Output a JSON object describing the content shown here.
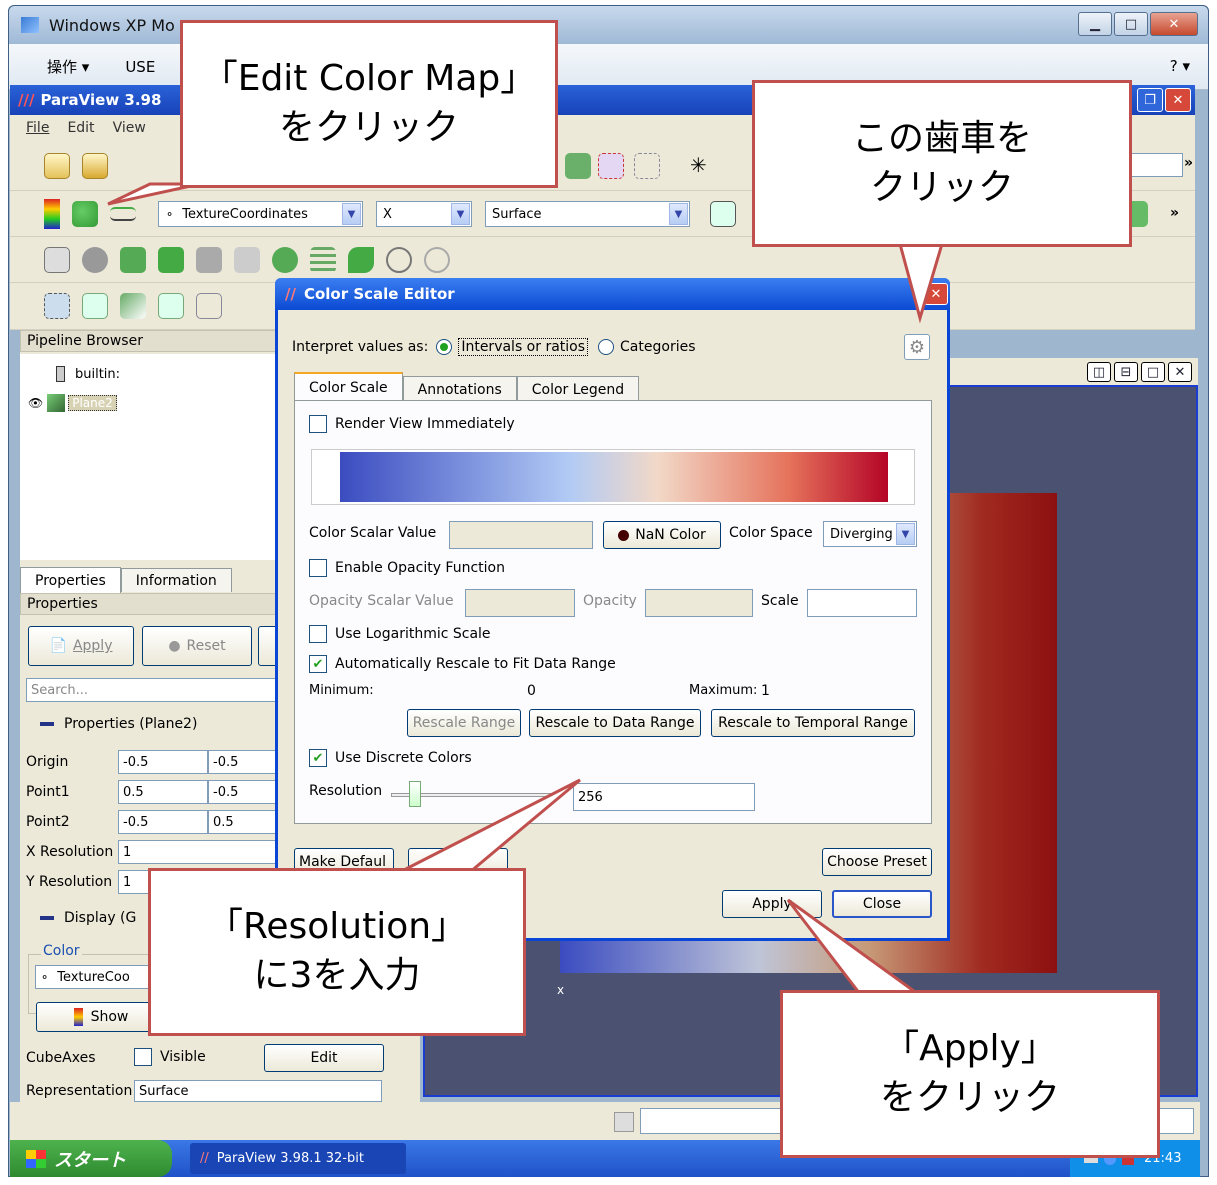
{
  "xp": {
    "title": "Windows XP Mo",
    "menu": [
      "操作 ▾",
      "USE"
    ],
    "help": "? ▾"
  },
  "pv": {
    "title": "ParaView 3.98",
    "menu": [
      "File",
      "Edit",
      "View"
    ]
  },
  "toolbar": {
    "array_combo": "TextureCoordinates",
    "component_combo": "X",
    "representation_combo": "Surface"
  },
  "pipeline": {
    "header": "Pipeline Browser",
    "root": "builtin:",
    "item": "Plane2"
  },
  "props": {
    "tabs": [
      "Properties",
      "Information"
    ],
    "header": "Properties",
    "apply": "Apply",
    "reset": "Reset",
    "search_placeholder": "Search...",
    "section": "Properties (Plane2)",
    "rows": [
      {
        "label": "Origin",
        "v1": "-0.5",
        "v2": "-0.5"
      },
      {
        "label": "Point1",
        "v1": "0.5",
        "v2": "-0.5"
      },
      {
        "label": "Point2",
        "v1": "-0.5",
        "v2": "0.5"
      }
    ],
    "xres_label": "X Resolution",
    "xres": "1",
    "yres_label": "Y Resolution",
    "yres": "1",
    "display_section": "Display (G",
    "color_group": "Color",
    "color_combo": "TextureCoo",
    "show_btn": "Show",
    "cubeaxes_label": "CubeAxes",
    "visible_label": "Visible",
    "edit_btn": "Edit",
    "repr_label": "Representation",
    "repr_value": "Surface"
  },
  "dialog": {
    "title": "Color Scale Editor",
    "interpret_label": "Interpret values as:",
    "opt_intervals": "Intervals or ratios",
    "opt_categories": "Categories",
    "tabs": [
      "Color Scale",
      "Annotations",
      "Color Legend"
    ],
    "render_immediately": "Render View Immediately",
    "color_scalar_label": "Color Scalar Value",
    "nan_color": "NaN Color",
    "color_space_label": "Color Space",
    "color_space_value": "Diverging",
    "enable_opacity": "Enable Opacity Function",
    "opacity_scalar_label": "Opacity Scalar Value",
    "opacity_label": "Opacity",
    "scale_label": "Scale",
    "use_log": "Use Logarithmic Scale",
    "auto_rescale": "Automatically Rescale to Fit Data Range",
    "minimum_label": "Minimum:",
    "minimum_value": "0",
    "maximum_label": "Maximum:",
    "maximum_value": "1",
    "rescale_range": "Rescale Range",
    "rescale_data": "Rescale to Data Range",
    "rescale_temporal": "Rescale to Temporal Range",
    "use_discrete": "Use Discrete Colors",
    "resolution_label": "Resolution",
    "resolution_value": "256",
    "make_default": "Make Defaul",
    "choose_preset": "Choose Preset",
    "apply": "Apply",
    "close": "Close"
  },
  "taskbar": {
    "start": "スタート",
    "task": "ParaView 3.98.1 32-bit",
    "time": "21:43"
  },
  "callouts": {
    "edit_color_map": [
      "「Edit Color Map」",
      "をクリック"
    ],
    "gear": [
      "この歯車を",
      "クリック"
    ],
    "resolution": [
      "「Resolution」",
      "に3を入力"
    ],
    "apply": [
      "「Apply」",
      "をクリック"
    ]
  },
  "colors": {
    "accent_red": "#c0504d",
    "xp_blue": "#0a46d6",
    "map_low": "#3b4cc0",
    "map_high": "#b40426"
  }
}
